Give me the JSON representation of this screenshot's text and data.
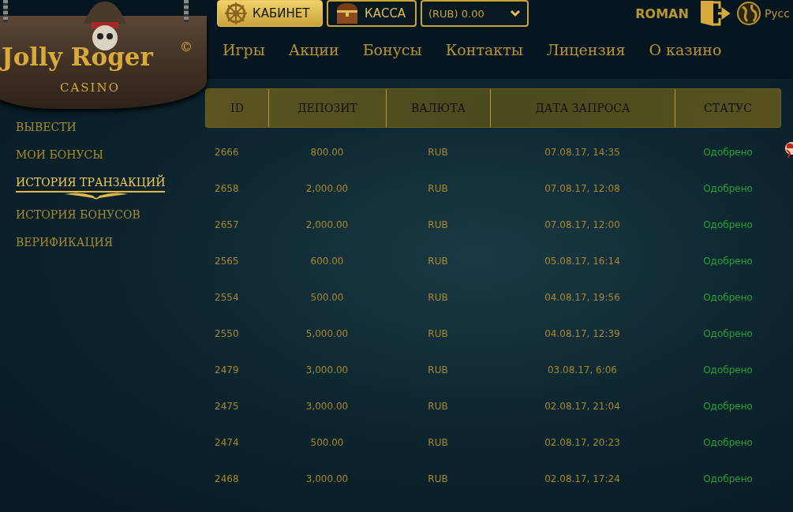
{
  "logo": {
    "title": "Jolly Roger",
    "mark": "©",
    "subtitle": "CASINO"
  },
  "top_bar": {
    "cabinet_button": "КАБИНЕТ",
    "cashier_button": "КАССА",
    "balance": "(RUB) 0.00",
    "username": "ROMAN",
    "language": "Русс"
  },
  "nav": [
    {
      "label": "Игры"
    },
    {
      "label": "Акции"
    },
    {
      "label": "Бонусы"
    },
    {
      "label": "Контакты"
    },
    {
      "label": "Лицензия"
    },
    {
      "label": "О казино"
    }
  ],
  "sidebar": {
    "items": [
      {
        "label": "ВЫВЕСТИ",
        "selected": false
      },
      {
        "label": "МОИ БОНУСЫ",
        "selected": false
      },
      {
        "label": "ИСТОРИЯ ТРАНЗАКЦИЙ",
        "selected": true
      },
      {
        "label": "ИСТОРИЯ БОНУСОВ",
        "selected": false
      },
      {
        "label": "ВЕРИФИКАЦИЯ",
        "selected": false
      }
    ]
  },
  "table": {
    "columns": [
      "ID",
      "ДЕПОЗИТ",
      "ВАЛЮТА",
      "ДАТА ЗАПРОСА",
      "СТАТУС"
    ],
    "rows": [
      [
        "2666",
        "800.00",
        "RUB",
        "07.08.17, 14:35",
        "Одобрено"
      ],
      [
        "2658",
        "2,000.00",
        "RUB",
        "07.08.17, 12:08",
        "Одобрено"
      ],
      [
        "2657",
        "2,000.00",
        "RUB",
        "07.08.17, 12:00",
        "Одобрено"
      ],
      [
        "2565",
        "600.00",
        "RUB",
        "05.08.17, 16:14",
        "Одобрено"
      ],
      [
        "2554",
        "500.00",
        "RUB",
        "04.08.17, 19:56",
        "Одобрено"
      ],
      [
        "2550",
        "5,000.00",
        "RUB",
        "04.08.17, 12:39",
        "Одобрено"
      ],
      [
        "2479",
        "3,000.00",
        "RUB",
        "03.08.17, 6:06",
        "Одобрено"
      ],
      [
        "2475",
        "3,000.00",
        "RUB",
        "02.08.17, 21:04",
        "Одобрено"
      ],
      [
        "2474",
        "500.00",
        "RUB",
        "02.08.17, 20:23",
        "Одобрено"
      ],
      [
        "2468",
        "3,000.00",
        "RUB",
        "02.08.17, 17:24",
        "Одобрено"
      ]
    ]
  }
}
